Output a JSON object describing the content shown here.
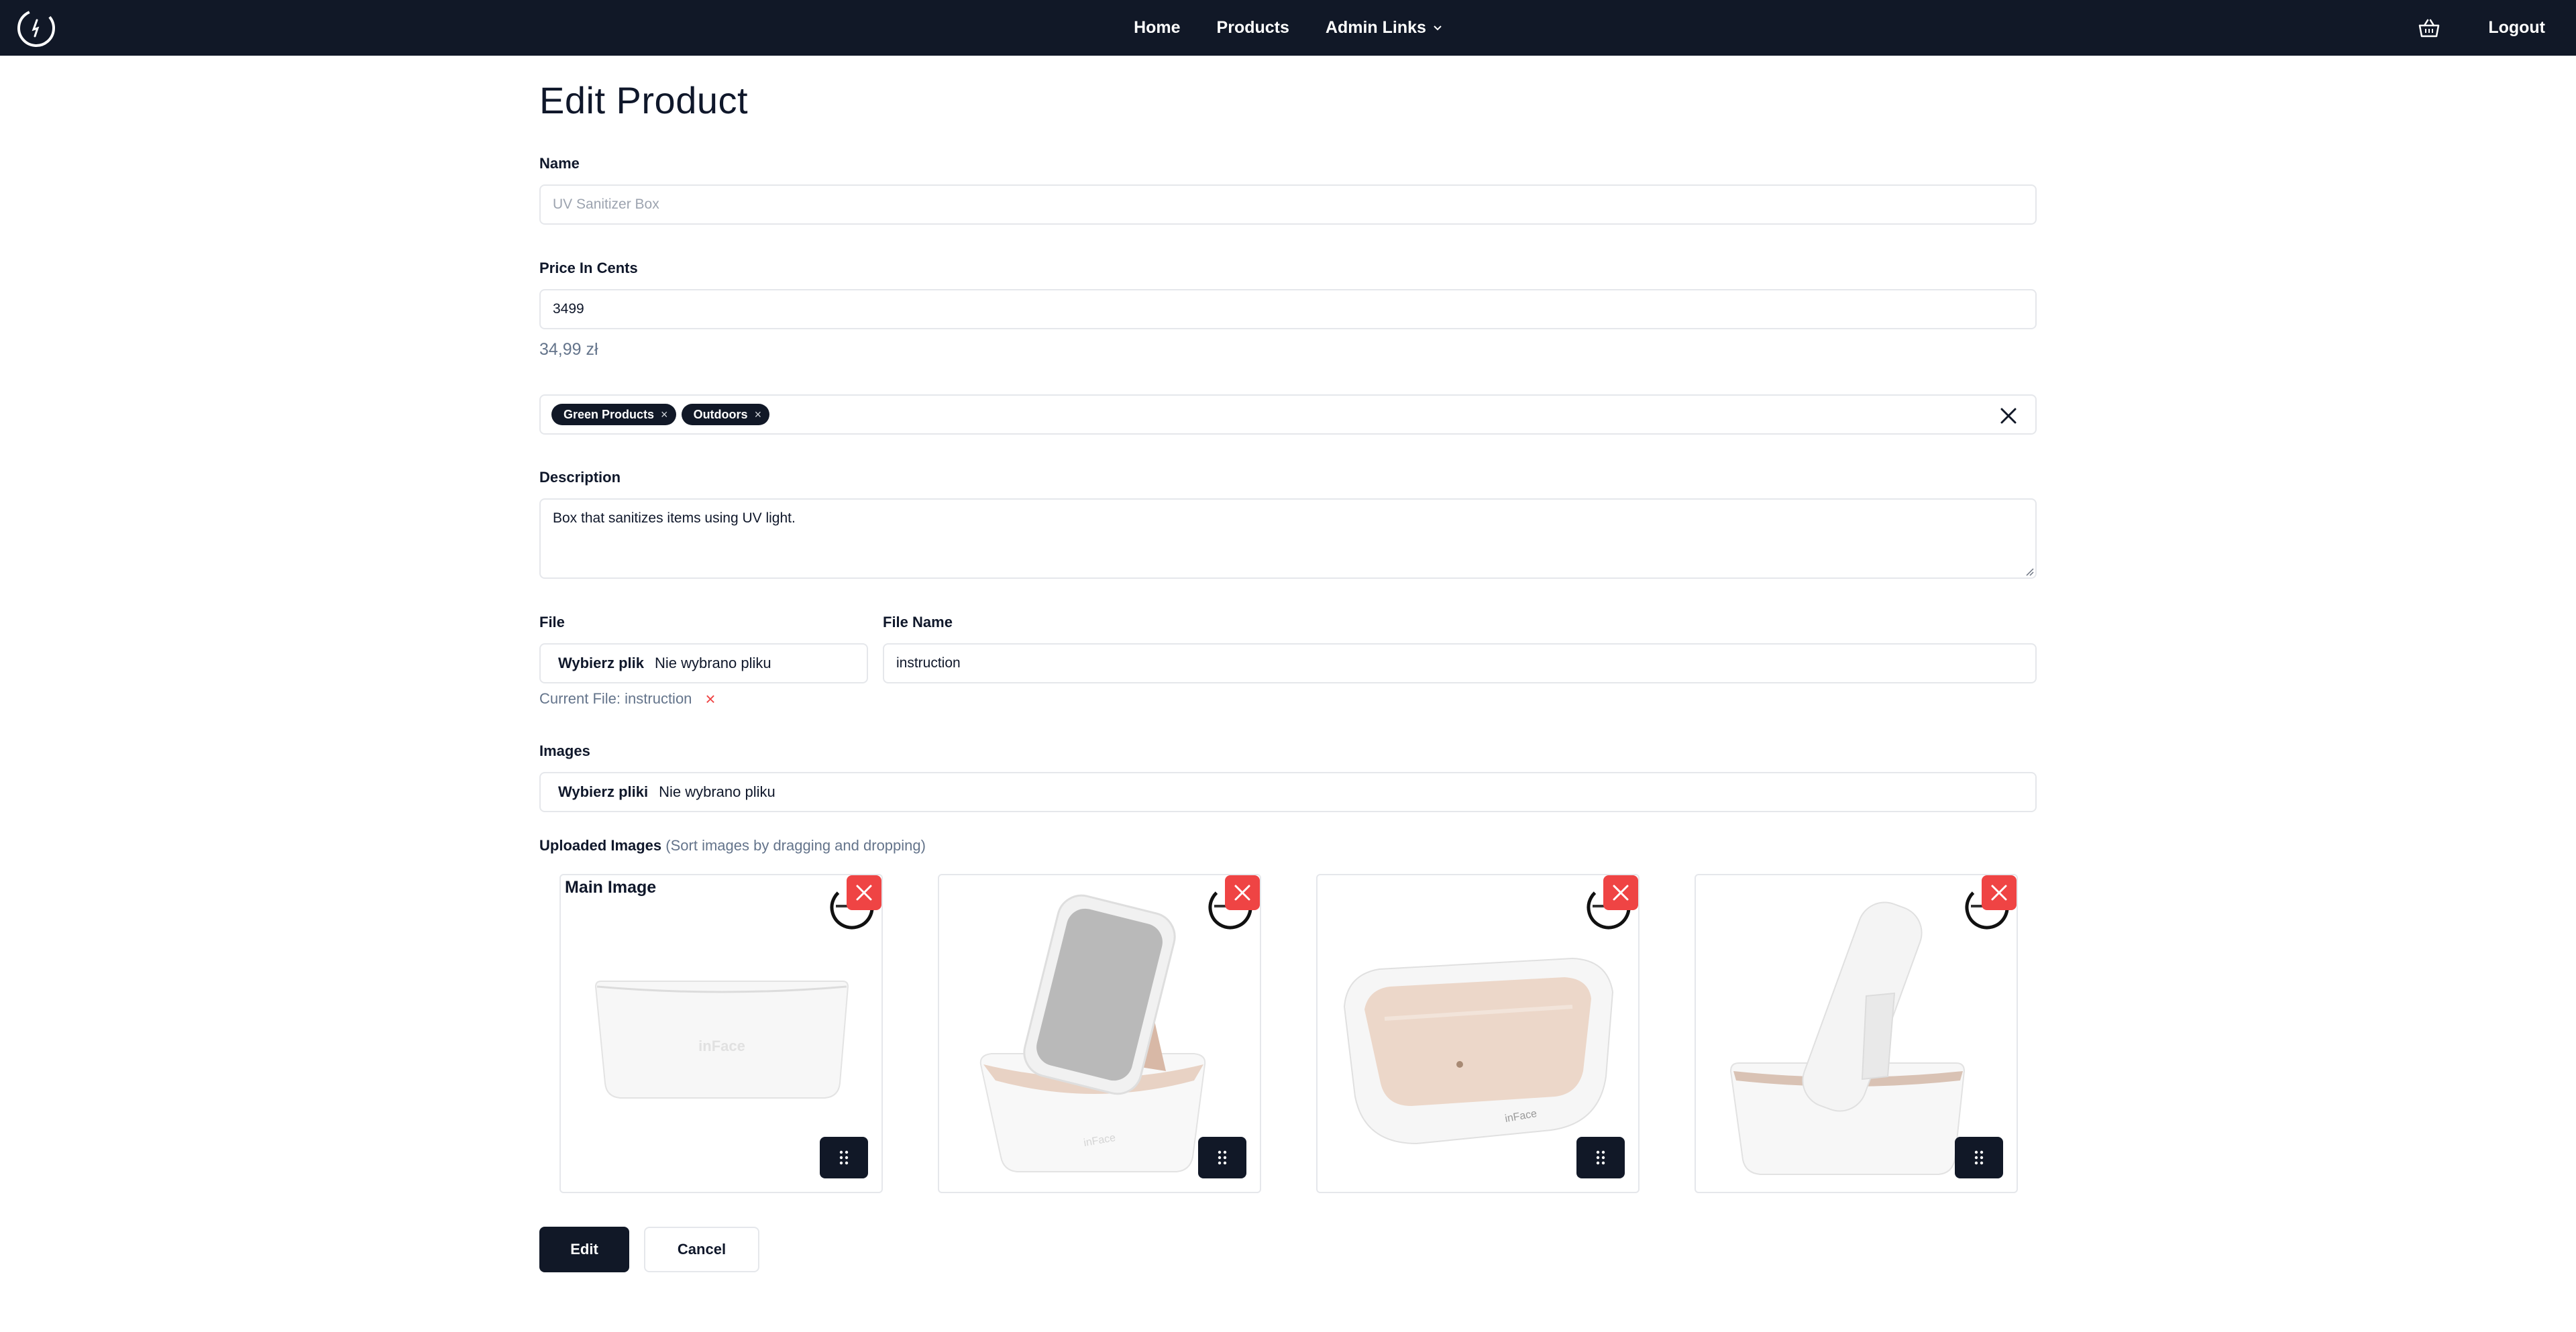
{
  "nav": {
    "home": "Home",
    "products": "Products",
    "admin_links": "Admin Links",
    "logout": "Logout"
  },
  "page_title": "Edit Product",
  "form": {
    "name_label": "Name",
    "name_placeholder": "UV Sanitizer Box",
    "price_label": "Price In Cents",
    "price_value": "3499",
    "price_formatted": "34,99 zł",
    "categories": [
      "Green Products",
      "Outdoors"
    ],
    "description_label": "Description",
    "description_value": "Box that sanitizes items using UV light.",
    "file_label": "File",
    "file_button": "Wybierz plik",
    "file_status": "Nie wybrano pliku",
    "file_name_label": "File Name",
    "file_name_value": "instruction",
    "current_file": "Current File: instruction",
    "images_label": "Images",
    "images_button": "Wybierz pliki",
    "images_status": "Nie wybrano pliku",
    "uploaded_images_label": "Uploaded Images",
    "uploaded_images_hint": "(Sort images by dragging and dropping)",
    "main_image_label": "Main Image",
    "edit_button": "Edit",
    "cancel_button": "Cancel"
  },
  "images": [
    {
      "depicts": "white UV sanitizer box, closed"
    },
    {
      "depicts": "UV sanitizer box with mirror lid open"
    },
    {
      "depicts": "open UV sanitizer box, top view"
    },
    {
      "depicts": "UV sanitizer box with phone inside"
    }
  ],
  "colors": {
    "navbar": "#111827",
    "danger": "#ef4444",
    "muted": "#64748b",
    "border": "#e5e7eb"
  }
}
